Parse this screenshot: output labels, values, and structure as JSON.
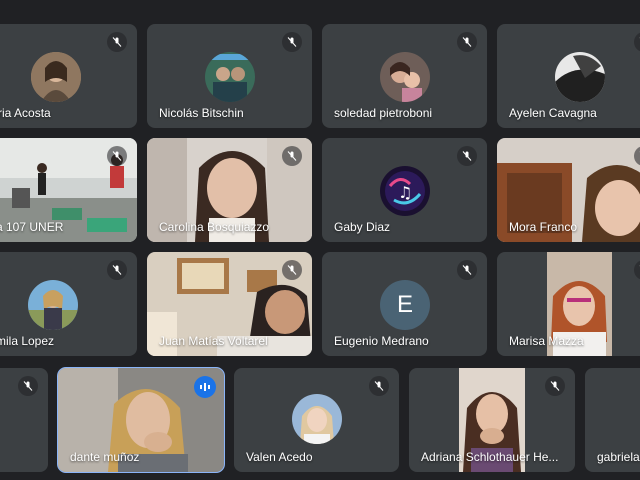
{
  "participants": [
    {
      "name": "toria Acosta",
      "muted": true
    },
    {
      "name": "Nicolás Bitschin",
      "muted": true
    },
    {
      "name": "soledad pietroboni",
      "muted": true
    },
    {
      "name": "Ayelen Cavagna",
      "muted": true
    },
    {
      "name": "a 107 UNER",
      "muted": true
    },
    {
      "name": "Carolina Bosquiazzo",
      "muted": true
    },
    {
      "name": "Gaby Diaz",
      "muted": true
    },
    {
      "name": "Mora Franco",
      "muted": true
    },
    {
      "name": "mila Lopez",
      "muted": true
    },
    {
      "name": "Juan Matías Voltarel",
      "muted": true
    },
    {
      "name": "Eugenio Medrano",
      "muted": true,
      "avatar_letter": "E"
    },
    {
      "name": "Marisa Mazza",
      "muted": true
    },
    {
      "name": "",
      "muted": true
    },
    {
      "name": "dante muñoz",
      "muted": false,
      "speaking": true
    },
    {
      "name": "Valen Acedo",
      "muted": true
    },
    {
      "name": "Adriana Schlothauer He...",
      "muted": true
    },
    {
      "name": "gabriela",
      "muted": false
    }
  ],
  "icons": {
    "muted": "mic-off-icon",
    "speaking": "audio-level-icon"
  },
  "colors": {
    "background": "#202124",
    "tile": "#3c4043",
    "active_outline": "#8ab4f8",
    "speaking": "#1a73e8"
  }
}
